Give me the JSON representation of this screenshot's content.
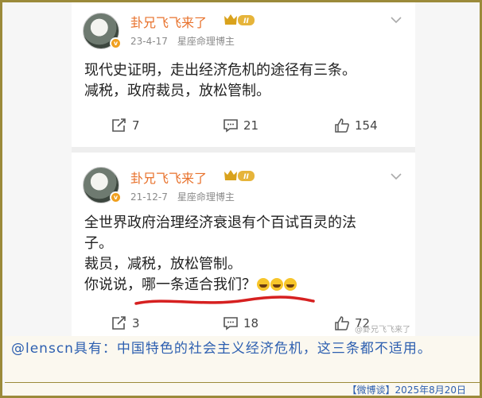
{
  "posts": [
    {
      "author": "卦兄飞飞来了",
      "level": "II",
      "date": "23-4-17",
      "role": "星座命理博主",
      "lines": [
        "现代史证明，走出经济危机的途径有三条。",
        "减税，政府裁员，放松管制。"
      ],
      "reposts": "7",
      "comments": "21",
      "likes": "154"
    },
    {
      "author": "卦兄飞飞来了",
      "level": "II",
      "date": "21-12-7",
      "role": "星座命理博主",
      "lines": [
        "全世界政府治理经济衰退有个百试百灵的法",
        "子。",
        "裁员，减税，放松管制。",
        "你说说，哪一条适合我们？"
      ],
      "reposts": "3",
      "comments": "18",
      "likes": "72",
      "watermark": "@卦兄飞飞来了"
    }
  ],
  "caption": "@lenscn具有：中国特色的社会主义经济危机，这三条都不适用。",
  "footer": "【微博谈】2025年8月20日",
  "colors": {
    "frame": "#9b8a3a",
    "caption_text": "#2d5fb0",
    "author": "#e8722c"
  }
}
